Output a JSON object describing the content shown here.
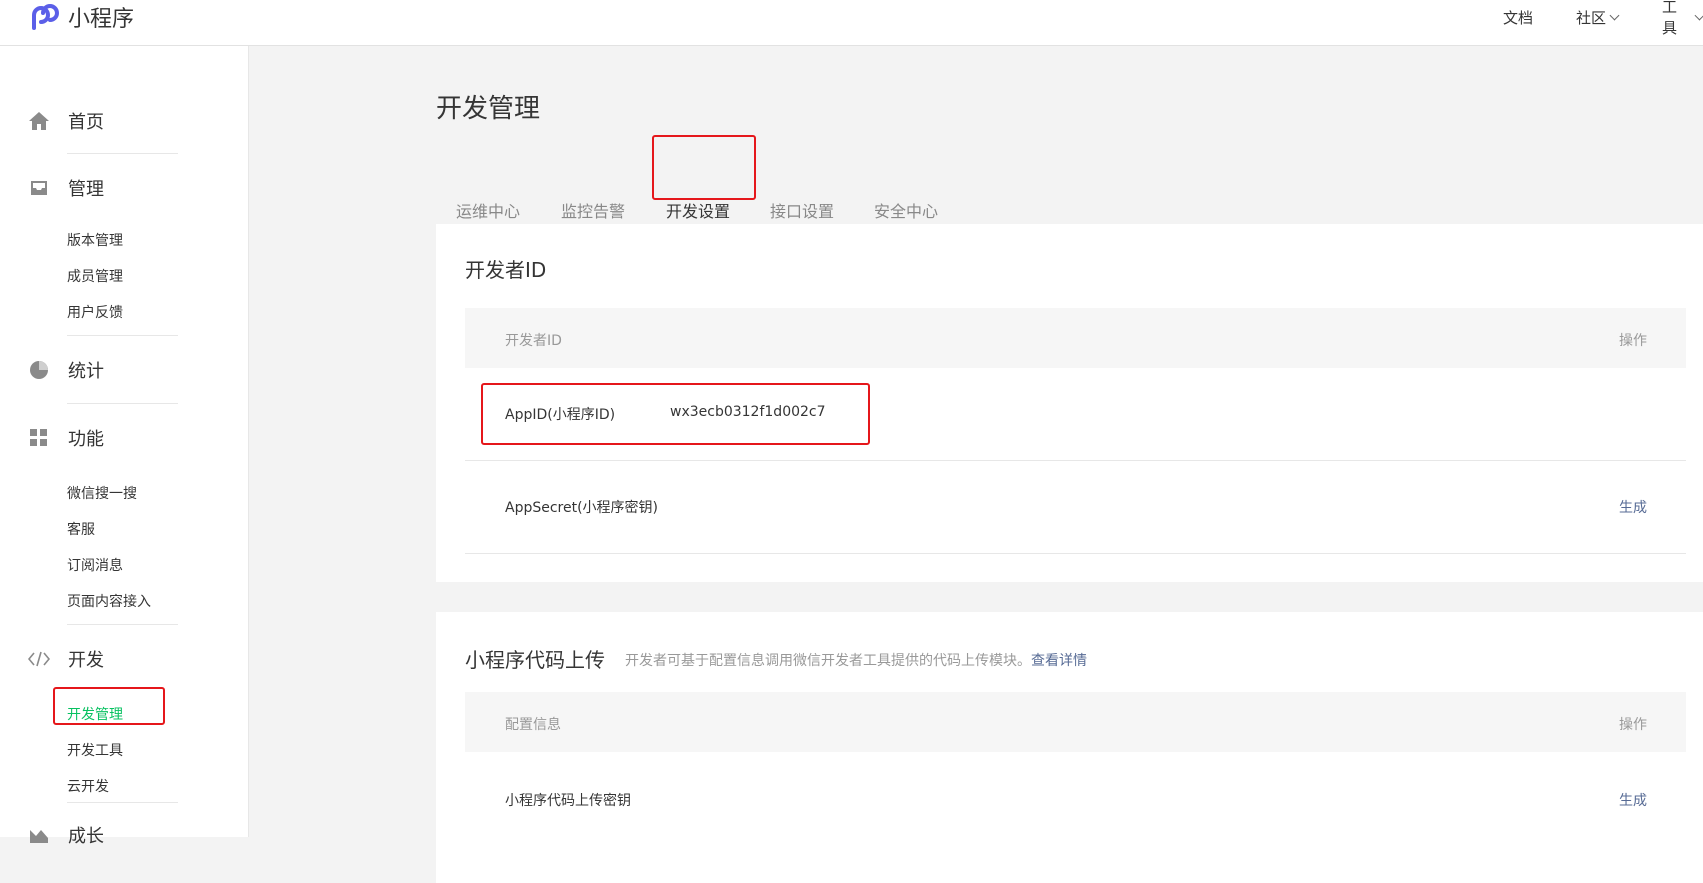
{
  "topbar": {
    "brand": "小程序",
    "nav": {
      "docs": "文档",
      "community": "社区",
      "tools": "工具"
    }
  },
  "sidebar": {
    "home": "首页",
    "manage": {
      "label": "管理",
      "items": [
        "版本管理",
        "成员管理",
        "用户反馈"
      ]
    },
    "stats": "统计",
    "features": {
      "label": "功能",
      "items": [
        "微信搜一搜",
        "客服",
        "订阅消息",
        "页面内容接入"
      ]
    },
    "develop": {
      "label": "开发",
      "items": [
        "开发管理",
        "开发工具",
        "云开发"
      ]
    },
    "growth": "成长"
  },
  "main": {
    "title": "开发管理",
    "tabs": [
      "运维中心",
      "监控告警",
      "开发设置",
      "接口设置",
      "安全中心"
    ],
    "active_tab": "开发设置",
    "dev_id": {
      "title": "开发者ID",
      "col_name": "开发者ID",
      "col_action": "操作",
      "appid_label": "AppID(小程序ID)",
      "appid_value": "wx3ecb0312f1d002c7",
      "secret_label": "AppSecret(小程序密钥)",
      "secret_action": "生成"
    },
    "upload": {
      "title": "小程序代码上传",
      "hint": "开发者可基于配置信息调用微信开发者工具提供的代码上传模块。",
      "hint_link": "查看详情",
      "col_name": "配置信息",
      "col_action": "操作",
      "key_label": "小程序代码上传密钥",
      "key_action": "生成"
    }
  },
  "colors": {
    "accent": "#07c160",
    "link": "#576b95",
    "highlight": "#e5171b",
    "brand": "#5b5fe8"
  }
}
